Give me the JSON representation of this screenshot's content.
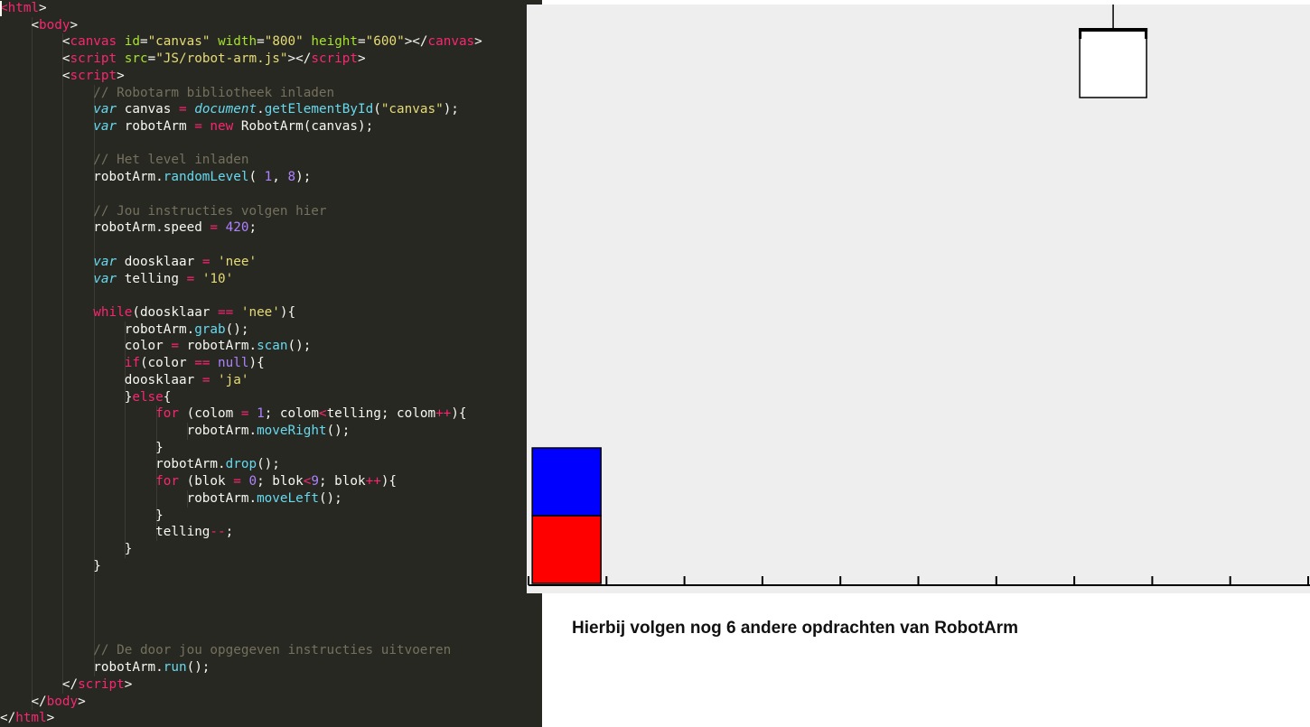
{
  "editor": {
    "lines": [
      [
        [
          "<",
          "tag"
        ],
        [
          "html",
          "tag"
        ],
        [
          ">",
          "punc"
        ]
      ],
      [
        [
          "    ",
          ""
        ],
        [
          "<",
          "punc"
        ],
        [
          "body",
          "tag"
        ],
        [
          ">",
          "punc"
        ]
      ],
      [
        [
          "        ",
          ""
        ],
        [
          "<",
          "punc"
        ],
        [
          "canvas",
          "tag"
        ],
        [
          " ",
          ""
        ],
        [
          "id",
          "attr"
        ],
        [
          "=",
          "punc"
        ],
        [
          "\"canvas\"",
          "str"
        ],
        [
          " ",
          ""
        ],
        [
          "width",
          "attr"
        ],
        [
          "=",
          "punc"
        ],
        [
          "\"800\"",
          "str"
        ],
        [
          " ",
          ""
        ],
        [
          "height",
          "attr"
        ],
        [
          "=",
          "punc"
        ],
        [
          "\"600\"",
          "str"
        ],
        [
          "></",
          "punc"
        ],
        [
          "canvas",
          "tag"
        ],
        [
          ">",
          "punc"
        ]
      ],
      [
        [
          "        ",
          ""
        ],
        [
          "<",
          "punc"
        ],
        [
          "script",
          "tag"
        ],
        [
          " ",
          ""
        ],
        [
          "src",
          "attr"
        ],
        [
          "=",
          "punc"
        ],
        [
          "\"JS/robot-arm.js\"",
          "str"
        ],
        [
          "></",
          "punc"
        ],
        [
          "script",
          "tag"
        ],
        [
          ">",
          "punc"
        ]
      ],
      [
        [
          "        ",
          ""
        ],
        [
          "<",
          "punc"
        ],
        [
          "script",
          "tag"
        ],
        [
          ">",
          "punc"
        ]
      ],
      [
        [
          "            ",
          ""
        ],
        [
          "// Robotarm bibliotheek inladen",
          "cmt"
        ]
      ],
      [
        [
          "            ",
          ""
        ],
        [
          "var",
          "kw"
        ],
        [
          " canvas ",
          ""
        ],
        [
          "=",
          "op"
        ],
        [
          " ",
          ""
        ],
        [
          "document",
          "glob"
        ],
        [
          ".",
          "punc"
        ],
        [
          "getElementById",
          "fn"
        ],
        [
          "(",
          "punc"
        ],
        [
          "\"canvas\"",
          "str"
        ],
        [
          ");",
          "punc"
        ]
      ],
      [
        [
          "            ",
          ""
        ],
        [
          "var",
          "kw"
        ],
        [
          " robotArm ",
          ""
        ],
        [
          "=",
          "op"
        ],
        [
          " ",
          ""
        ],
        [
          "new",
          "kwr"
        ],
        [
          " RobotArm(canvas);",
          ""
        ]
      ],
      [],
      [
        [
          "            ",
          ""
        ],
        [
          "// Het level inladen",
          "cmt"
        ]
      ],
      [
        [
          "            ",
          ""
        ],
        [
          "robotArm.",
          ""
        ],
        [
          "randomLevel",
          "fn"
        ],
        [
          "( ",
          ""
        ],
        [
          "1",
          "num"
        ],
        [
          ", ",
          ""
        ],
        [
          "8",
          "num"
        ],
        [
          ");",
          ""
        ]
      ],
      [],
      [
        [
          "            ",
          ""
        ],
        [
          "// Jou instructies volgen hier",
          "cmt"
        ]
      ],
      [
        [
          "            ",
          ""
        ],
        [
          "robotArm.speed ",
          ""
        ],
        [
          "=",
          "op"
        ],
        [
          " ",
          ""
        ],
        [
          "420",
          "num"
        ],
        [
          ";",
          ""
        ]
      ],
      [],
      [
        [
          "            ",
          ""
        ],
        [
          "var",
          "kw"
        ],
        [
          " doosklaar ",
          ""
        ],
        [
          "=",
          "op"
        ],
        [
          " ",
          ""
        ],
        [
          "'nee'",
          "str"
        ]
      ],
      [
        [
          "            ",
          ""
        ],
        [
          "var",
          "kw"
        ],
        [
          " telling ",
          ""
        ],
        [
          "=",
          "op"
        ],
        [
          " ",
          ""
        ],
        [
          "'10'",
          "str"
        ]
      ],
      [],
      [
        [
          "            ",
          ""
        ],
        [
          "while",
          "kwr"
        ],
        [
          "(doosklaar ",
          ""
        ],
        [
          "==",
          "op"
        ],
        [
          " ",
          ""
        ],
        [
          "'nee'",
          "str"
        ],
        [
          "){",
          ""
        ]
      ],
      [
        [
          "                ",
          ""
        ],
        [
          "robotArm.",
          ""
        ],
        [
          "grab",
          "fn"
        ],
        [
          "();",
          ""
        ]
      ],
      [
        [
          "                ",
          ""
        ],
        [
          "color ",
          ""
        ],
        [
          "=",
          "op"
        ],
        [
          " robotArm.",
          ""
        ],
        [
          "scan",
          "fn"
        ],
        [
          "();",
          ""
        ]
      ],
      [
        [
          "                ",
          ""
        ],
        [
          "if",
          "kwr"
        ],
        [
          "(color ",
          ""
        ],
        [
          "==",
          "op"
        ],
        [
          " ",
          ""
        ],
        [
          "null",
          "num"
        ],
        [
          "){",
          ""
        ]
      ],
      [
        [
          "                ",
          ""
        ],
        [
          "doosklaar ",
          ""
        ],
        [
          "=",
          "op"
        ],
        [
          " ",
          ""
        ],
        [
          "'ja'",
          "str"
        ]
      ],
      [
        [
          "                ",
          ""
        ],
        [
          "}",
          ""
        ],
        [
          "else",
          "kwr"
        ],
        [
          "{",
          ""
        ]
      ],
      [
        [
          "                    ",
          ""
        ],
        [
          "for",
          "kwr"
        ],
        [
          " (colom ",
          ""
        ],
        [
          "=",
          "op"
        ],
        [
          " ",
          ""
        ],
        [
          "1",
          "num"
        ],
        [
          "; colom",
          ""
        ],
        [
          "<",
          "op"
        ],
        [
          "telling; colom",
          ""
        ],
        [
          "++",
          "op"
        ],
        [
          "){",
          ""
        ]
      ],
      [
        [
          "                        ",
          ""
        ],
        [
          "robotArm.",
          ""
        ],
        [
          "moveRight",
          "fn"
        ],
        [
          "();",
          ""
        ]
      ],
      [
        [
          "                    ",
          ""
        ],
        [
          "}",
          ""
        ]
      ],
      [
        [
          "                    ",
          ""
        ],
        [
          "robotArm.",
          ""
        ],
        [
          "drop",
          "fn"
        ],
        [
          "();",
          ""
        ]
      ],
      [
        [
          "                    ",
          ""
        ],
        [
          "for",
          "kwr"
        ],
        [
          " (blok ",
          ""
        ],
        [
          "=",
          "op"
        ],
        [
          " ",
          ""
        ],
        [
          "0",
          "num"
        ],
        [
          "; blok",
          ""
        ],
        [
          "<",
          "op"
        ],
        [
          "9",
          "num"
        ],
        [
          "; blok",
          ""
        ],
        [
          "++",
          "op"
        ],
        [
          "){",
          ""
        ]
      ],
      [
        [
          "                        ",
          ""
        ],
        [
          "robotArm.",
          ""
        ],
        [
          "moveLeft",
          "fn"
        ],
        [
          "();",
          ""
        ]
      ],
      [
        [
          "                    ",
          ""
        ],
        [
          "}",
          ""
        ]
      ],
      [
        [
          "                    ",
          ""
        ],
        [
          "telling",
          ""
        ],
        [
          "--",
          "op"
        ],
        [
          ";",
          ""
        ]
      ],
      [
        [
          "                ",
          ""
        ],
        [
          "}",
          ""
        ]
      ],
      [
        [
          "            ",
          ""
        ],
        [
          "}",
          ""
        ]
      ],
      [],
      [],
      [],
      [],
      [
        [
          "            ",
          ""
        ],
        [
          "// De door jou opgegeven instructies uitvoeren",
          "cmt"
        ]
      ],
      [
        [
          "            ",
          ""
        ],
        [
          "robotArm.",
          ""
        ],
        [
          "run",
          "fn"
        ],
        [
          "();",
          ""
        ]
      ],
      [
        [
          "        ",
          ""
        ],
        [
          "</",
          "punc"
        ],
        [
          "script",
          "tag"
        ],
        [
          ">",
          "punc"
        ]
      ],
      [
        [
          "    ",
          ""
        ],
        [
          "</",
          "punc"
        ],
        [
          "body",
          "tag"
        ],
        [
          ">",
          "punc"
        ]
      ],
      [
        [
          "</",
          "punc"
        ],
        [
          "html",
          "tag"
        ],
        [
          ">",
          "punc"
        ]
      ]
    ]
  },
  "robot_canvas": {
    "background": "#eeeeee",
    "ground_slots": 10,
    "stacks": [
      {
        "slot": 0,
        "blocks": [
          "#ff0000",
          "#0000ff"
        ]
      }
    ],
    "arm_slot": 7,
    "arm_holding": null
  },
  "caption": "Hierbij volgen nog 6 andere opdrachten van RobotArm"
}
